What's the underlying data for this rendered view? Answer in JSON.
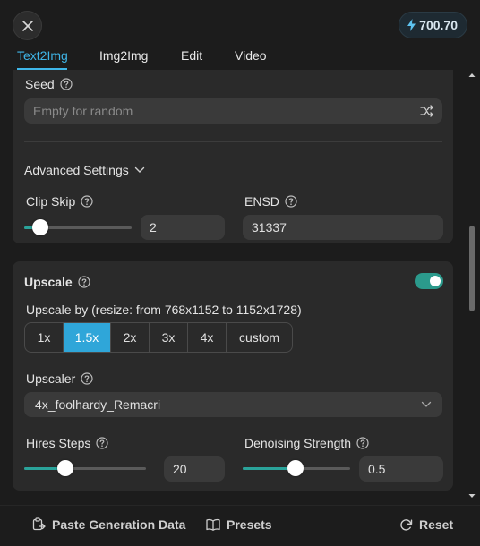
{
  "credits": {
    "value": "700.70",
    "icon": "lightning-icon"
  },
  "tabs": [
    {
      "label": "Text2Img",
      "active": true
    },
    {
      "label": "Img2Img"
    },
    {
      "label": "Edit"
    },
    {
      "label": "Video"
    }
  ],
  "seed": {
    "label": "Seed",
    "placeholder": "Empty for random"
  },
  "advanced": {
    "label": "Advanced Settings"
  },
  "clip_skip": {
    "label": "Clip Skip",
    "value": "2",
    "slider_fraction": 0.15
  },
  "ensd": {
    "label": "ENSD",
    "value": "31337"
  },
  "upscale": {
    "label": "Upscale",
    "enabled": true,
    "upscale_by_label": "Upscale by (resize: from 768x1152 to 1152x1728)",
    "options": [
      "1x",
      "1.5x",
      "2x",
      "3x",
      "4x",
      "custom"
    ],
    "selected": "1.5x",
    "upscaler_label": "Upscaler",
    "upscaler_value": "4x_foolhardy_Remacri",
    "hires_steps_label": "Hires Steps",
    "hires_steps_value": "20",
    "hires_steps_fraction": 0.34,
    "denoising_label": "Denoising Strength",
    "denoising_value": "0.5",
    "denoising_fraction": 0.5
  },
  "footer": {
    "paste": "Paste Generation Data",
    "presets": "Presets",
    "reset": "Reset"
  },
  "colors": {
    "accent": "#3fb6e8",
    "toggle": "#2b9a8c",
    "segment_active": "#2fa6d9"
  }
}
